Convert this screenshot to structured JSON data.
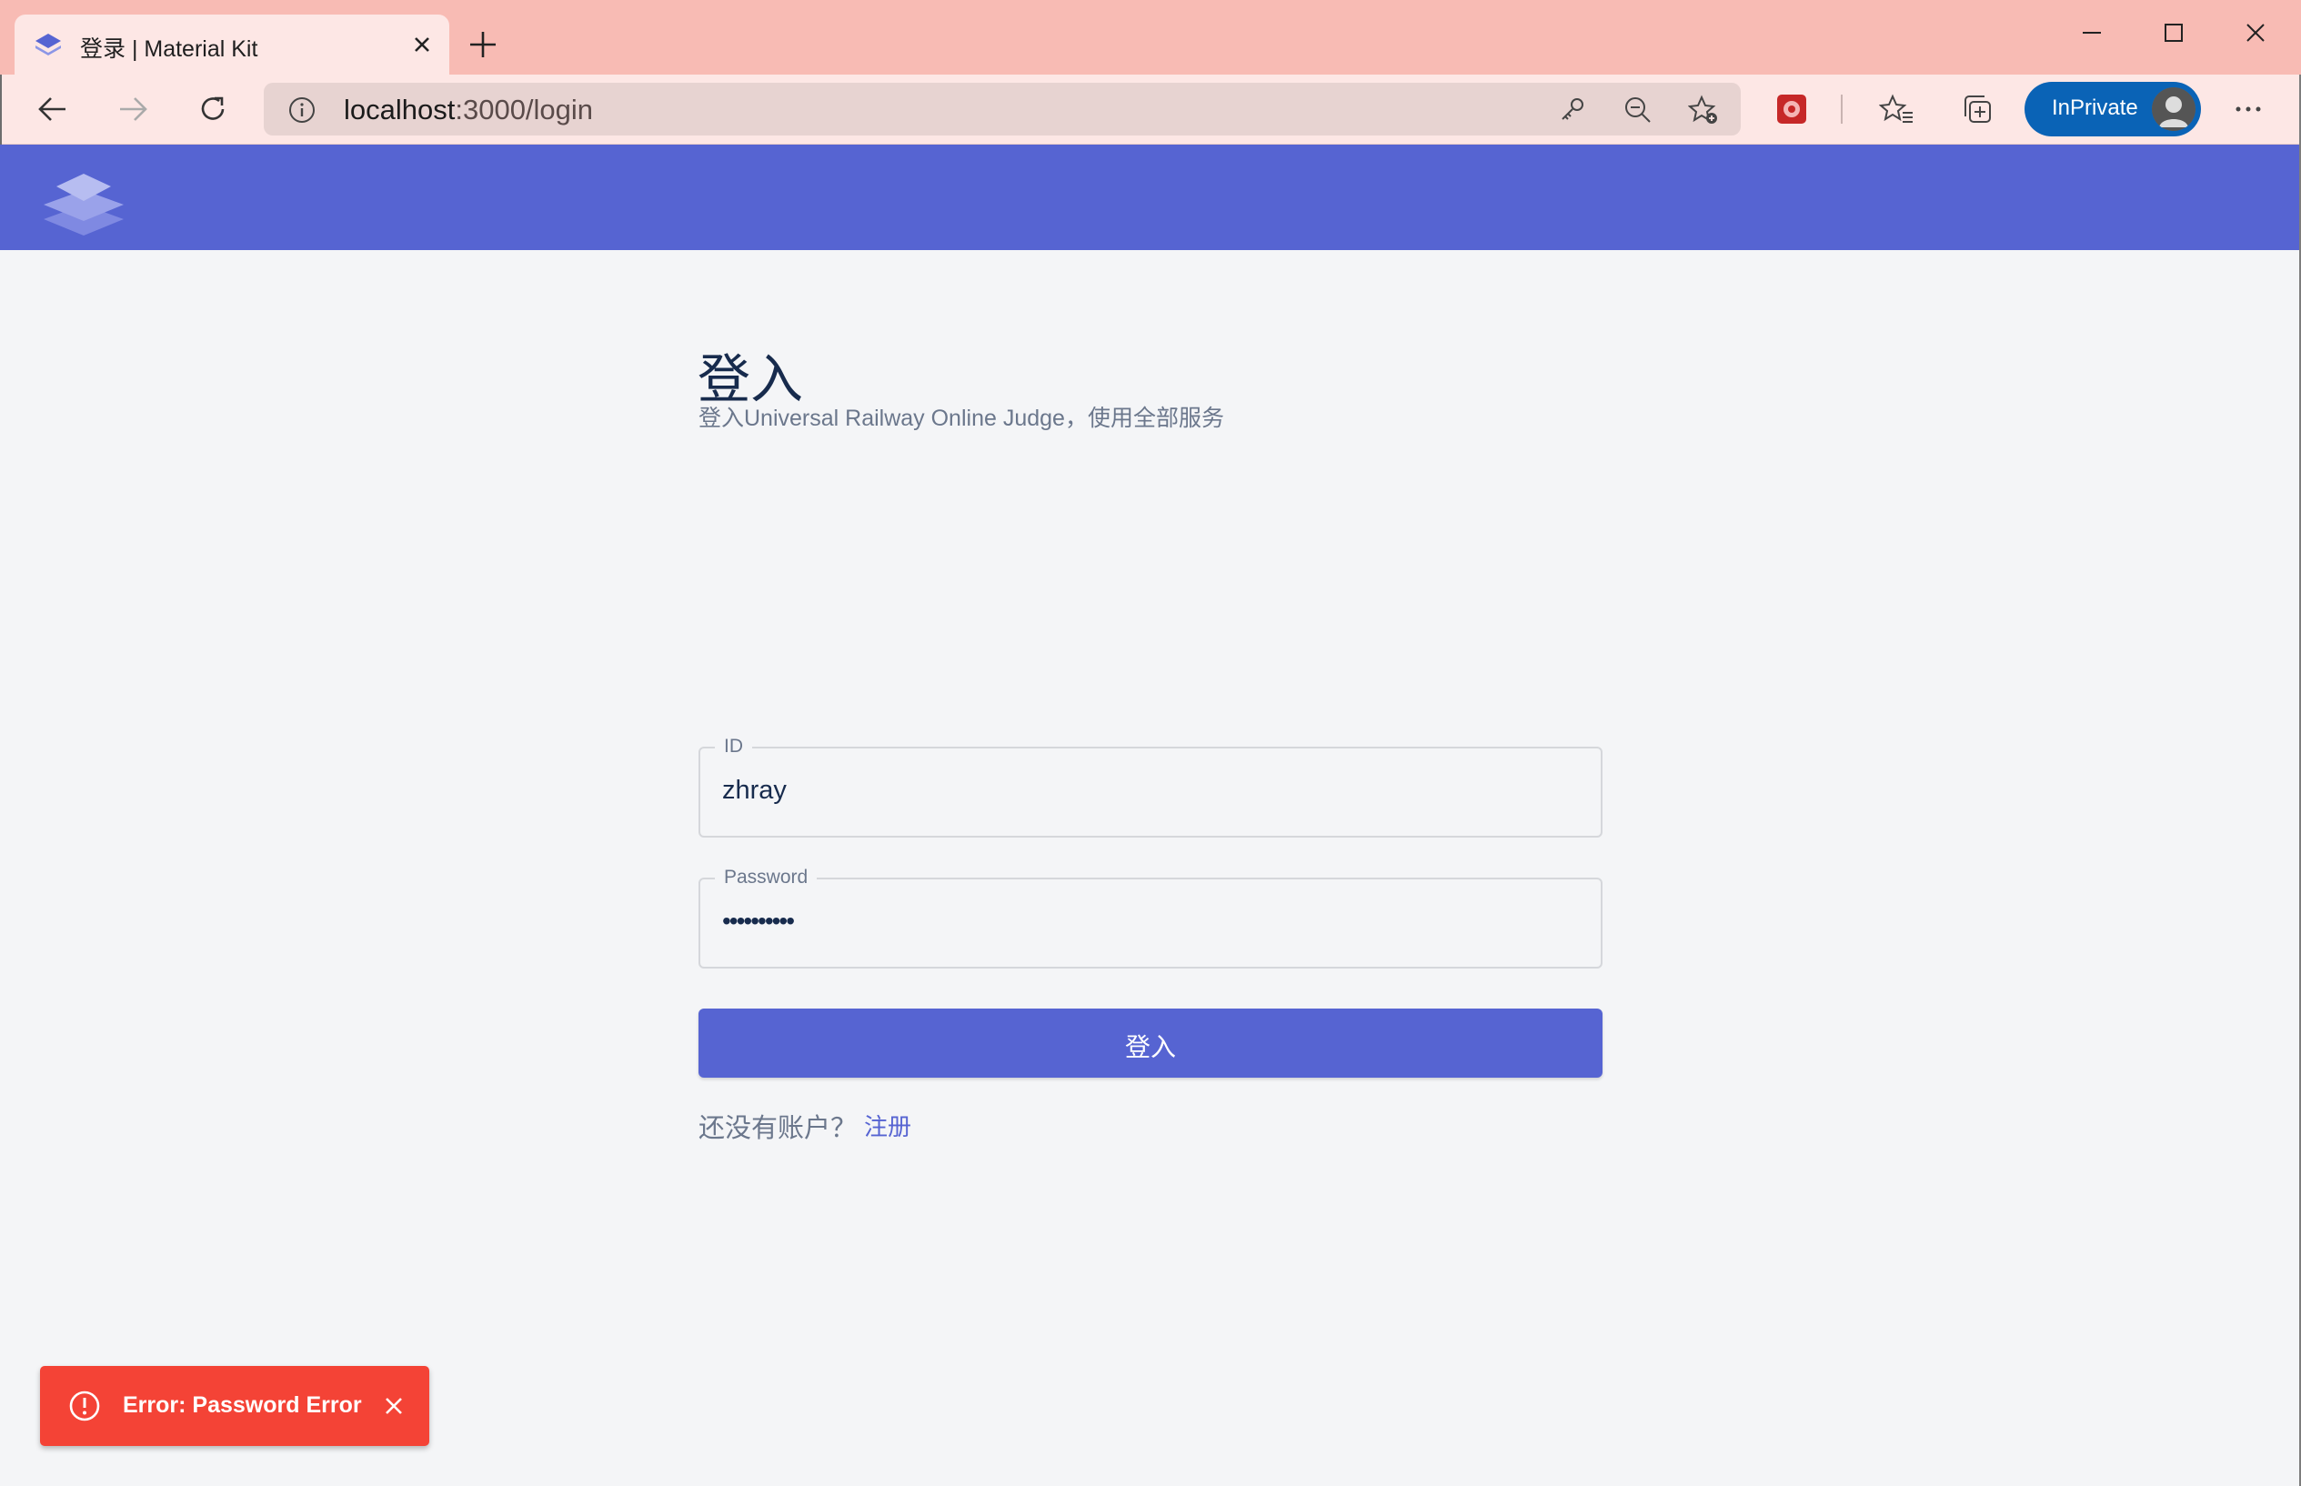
{
  "browser": {
    "tab": {
      "title": "登录 | Material Kit"
    },
    "address": {
      "host": "localhost",
      "path": ":3000/login"
    },
    "profile": {
      "label": "InPrivate"
    },
    "icons": {
      "favicon": "layers-icon",
      "tab_close": "close-icon",
      "new_tab": "plus-icon",
      "back": "back-arrow-icon",
      "forward": "forward-arrow-icon",
      "refresh": "refresh-icon",
      "info": "info-icon",
      "key": "key-icon",
      "zoom": "zoom-out-icon",
      "favorite": "star-add-icon",
      "extension": "extension-icon",
      "favorites": "favorites-icon",
      "collections": "collections-icon",
      "menu": "more-icon"
    }
  },
  "app": {
    "logo": "layers-logo-icon",
    "brand_color": "#5664d2"
  },
  "login": {
    "title": "登入",
    "subtitle": "登入Universal Railway Online Judge，使用全部服务",
    "id_field": {
      "label": "ID",
      "value": "zhray"
    },
    "password_field": {
      "label": "Password",
      "value": "••••••••••"
    },
    "submit_label": "登入",
    "no_account_text": "还没有账户？",
    "register_link": "注册"
  },
  "snackbar": {
    "message": "Error: Password Error",
    "color": "#f44336"
  }
}
